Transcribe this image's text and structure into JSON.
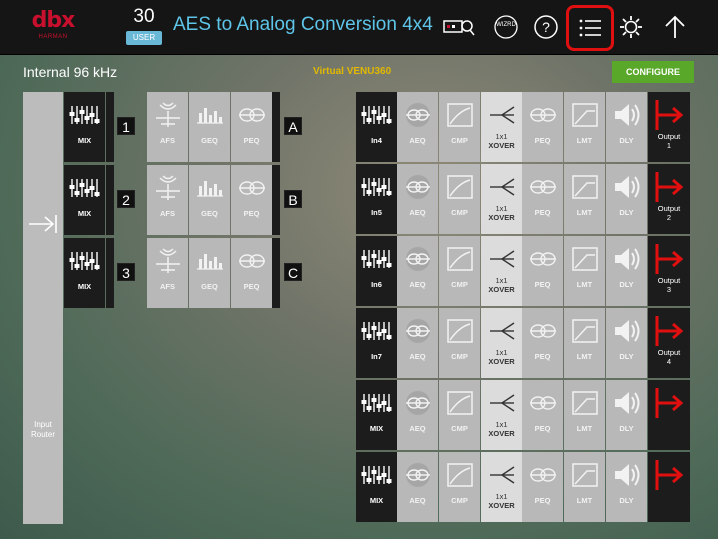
{
  "header": {
    "logo_text": "dbx",
    "logo_sub": "HARMAN",
    "preset_number": "30",
    "preset_type": "USER",
    "title": "AES to Analog Conversion 4x4",
    "wizard_label": "WIZRD",
    "icons": [
      "keyboard-search-icon",
      "wizard-icon",
      "help-icon",
      "list-menu-icon",
      "settings-icon",
      "home-up-icon"
    ]
  },
  "sample_rate": "Internal 96 kHz",
  "virtual_device": "Virtual VENU360",
  "configure_label": "CONFIGURE",
  "input_router_label": "Input\nRouter",
  "left_rows": [
    {
      "mix": "MIX",
      "num": "1",
      "blocks": [
        "AFS",
        "GEQ",
        "PEQ"
      ],
      "letter": "A"
    },
    {
      "mix": "MIX",
      "num": "2",
      "blocks": [
        "AFS",
        "GEQ",
        "PEQ"
      ],
      "letter": "B"
    },
    {
      "mix": "MIX",
      "num": "3",
      "blocks": [
        "AFS",
        "GEQ",
        "PEQ"
      ],
      "letter": "C"
    }
  ],
  "right_rows": [
    {
      "in": "In4",
      "blocks": [
        "AEQ",
        "CMP"
      ],
      "xover_top": "1x1",
      "xover": "XOVER",
      "post": [
        "PEQ",
        "LMT",
        "DLY"
      ],
      "output": "Output\n1"
    },
    {
      "in": "In5",
      "blocks": [
        "AEQ",
        "CMP"
      ],
      "xover_top": "1x1",
      "xover": "XOVER",
      "post": [
        "PEQ",
        "LMT",
        "DLY"
      ],
      "output": "Output\n2"
    },
    {
      "in": "In6",
      "blocks": [
        "AEQ",
        "CMP"
      ],
      "xover_top": "1x1",
      "xover": "XOVER",
      "post": [
        "PEQ",
        "LMT",
        "DLY"
      ],
      "output": "Output\n3"
    },
    {
      "in": "In7",
      "blocks": [
        "AEQ",
        "CMP"
      ],
      "xover_top": "1x1",
      "xover": "XOVER",
      "post": [
        "PEQ",
        "LMT",
        "DLY"
      ],
      "output": "Output\n4"
    },
    {
      "in": "MIX",
      "blocks": [
        "AEQ",
        "CMP"
      ],
      "xover_top": "1x1",
      "xover": "XOVER",
      "post": [
        "PEQ",
        "LMT",
        "DLY"
      ],
      "output": ""
    },
    {
      "in": "MIX",
      "blocks": [
        "AEQ",
        "CMP"
      ],
      "xover_top": "1x1",
      "xover": "XOVER",
      "post": [
        "PEQ",
        "LMT",
        "DLY"
      ],
      "output": ""
    }
  ],
  "colors": {
    "accent": "#5ec4e8",
    "brand": "#c8102e",
    "output_arrow": "#e01010",
    "configure": "#5aa829",
    "virtual": "#e2b800"
  }
}
